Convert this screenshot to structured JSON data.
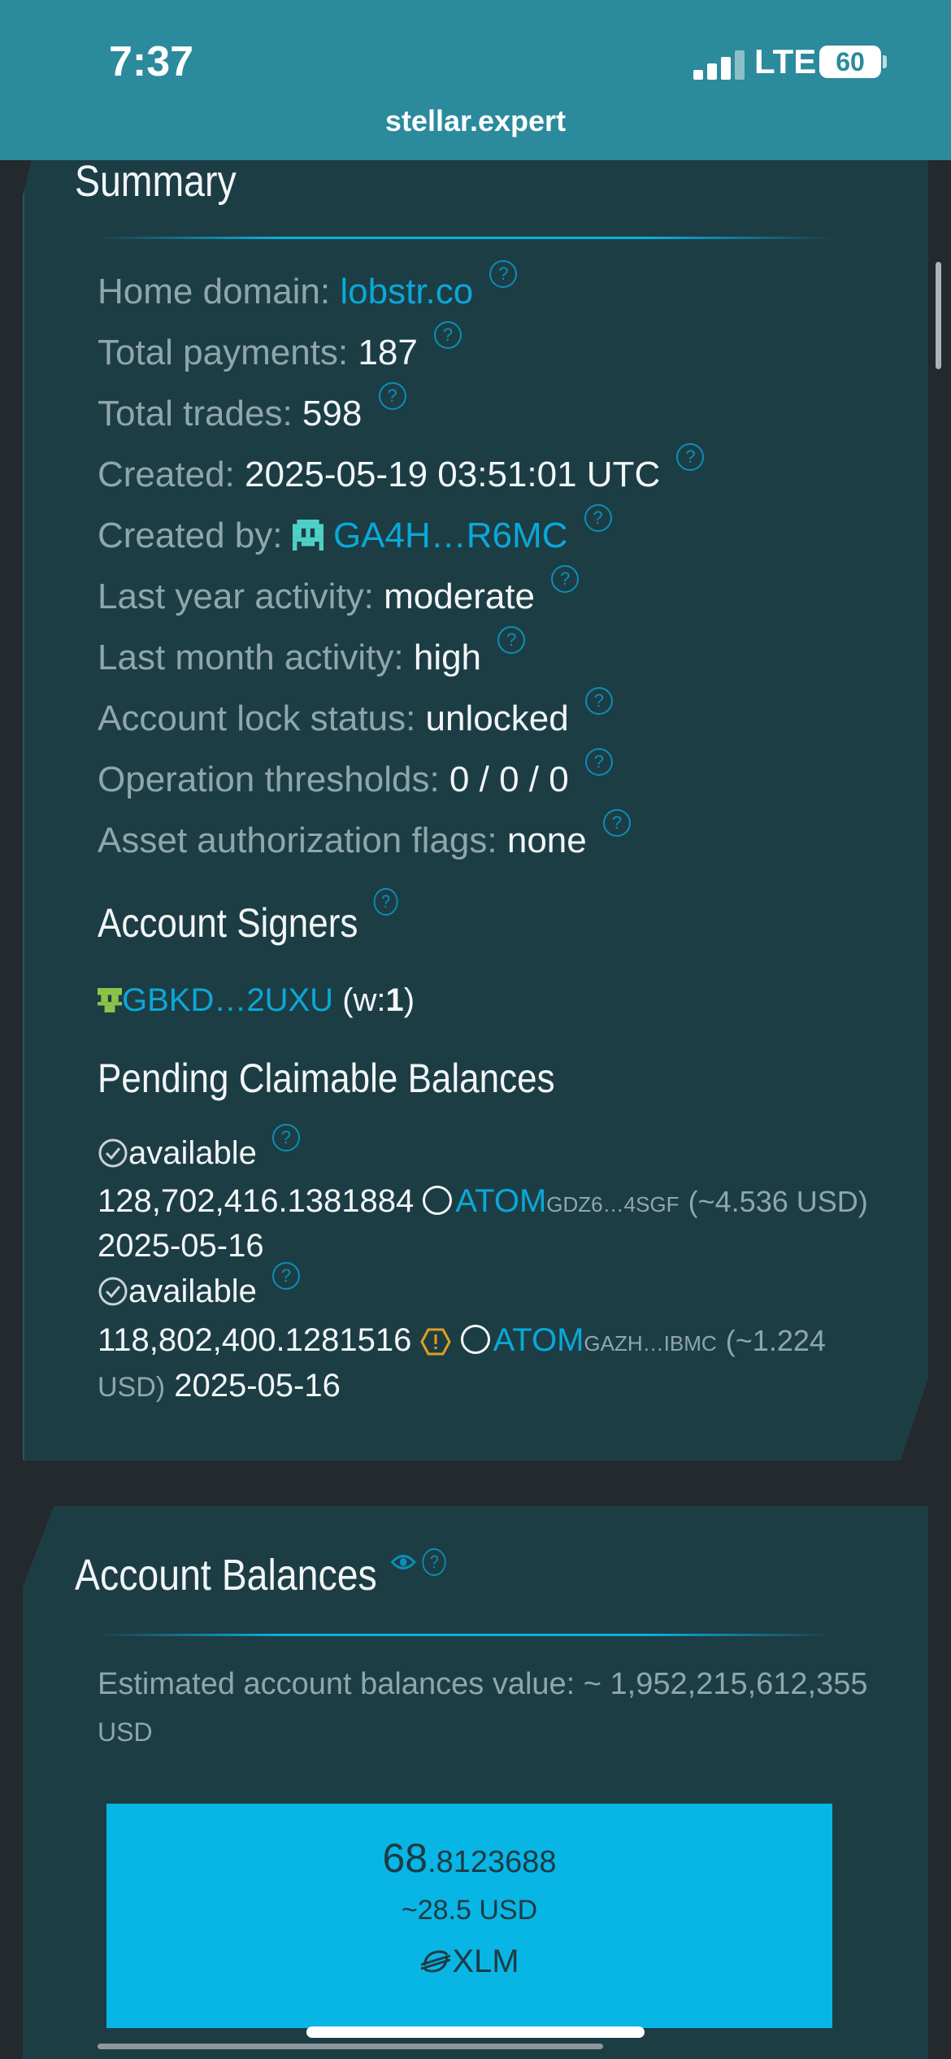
{
  "status": {
    "time": "7:37",
    "network": "LTE",
    "battery": "60",
    "url": "stellar.expert"
  },
  "summary": {
    "title": "Summary",
    "home_domain_label": "Home domain:",
    "home_domain": "lobstr.co",
    "total_payments_label": "Total payments:",
    "total_payments": "187",
    "total_trades_label": "Total trades:",
    "total_trades": "598",
    "created_label": "Created:",
    "created": "2025-05-19 03:51:01 UTC",
    "created_by_label": "Created by:",
    "created_by": "GA4H…R6MC",
    "last_year_label": "Last year activity:",
    "last_year": "moderate",
    "last_month_label": "Last month activity:",
    "last_month": "high",
    "lock_label": "Account lock status:",
    "lock": "unlocked",
    "thresholds_label": "Operation thresholds:",
    "thresholds": "0 / 0 / 0",
    "flags_label": "Asset authorization flags:",
    "flags": "none",
    "help_glyph": "?"
  },
  "signers": {
    "title": "Account Signers",
    "signer": "GBKD…2UXU",
    "weight_prefix": "(w:",
    "weight": "1",
    "weight_suffix": ")"
  },
  "claimable": {
    "title": "Pending Claimable Balances",
    "items": [
      {
        "status": "available",
        "amount": "128,702,416.1381884",
        "asset": "ATOM",
        "issuer": "GDZ6…4SGF",
        "usd": "(~4.536 USD)",
        "date": "2025-05-16"
      },
      {
        "status": "available",
        "amount": "118,802,400.1281516",
        "asset": "ATOM",
        "issuer": "GAZH…IBMC",
        "usd_line1": "(~1.224",
        "usd_line2": "USD)",
        "date": "2025-05-16"
      }
    ]
  },
  "balances": {
    "title": "Account Balances",
    "estimate_line1": "Estimated account balances value: ~ 1,952,215,612,355",
    "estimate_line2": "USD",
    "card": {
      "amount_int": "68",
      "amount_dec": ".8123688",
      "usd": "~28.5 USD",
      "asset": "XLM"
    }
  },
  "colors": {
    "header": "#2b8a9c",
    "panel": "#1d3d45",
    "link": "#0aa8d8",
    "accent_card": "#07b6e4"
  }
}
